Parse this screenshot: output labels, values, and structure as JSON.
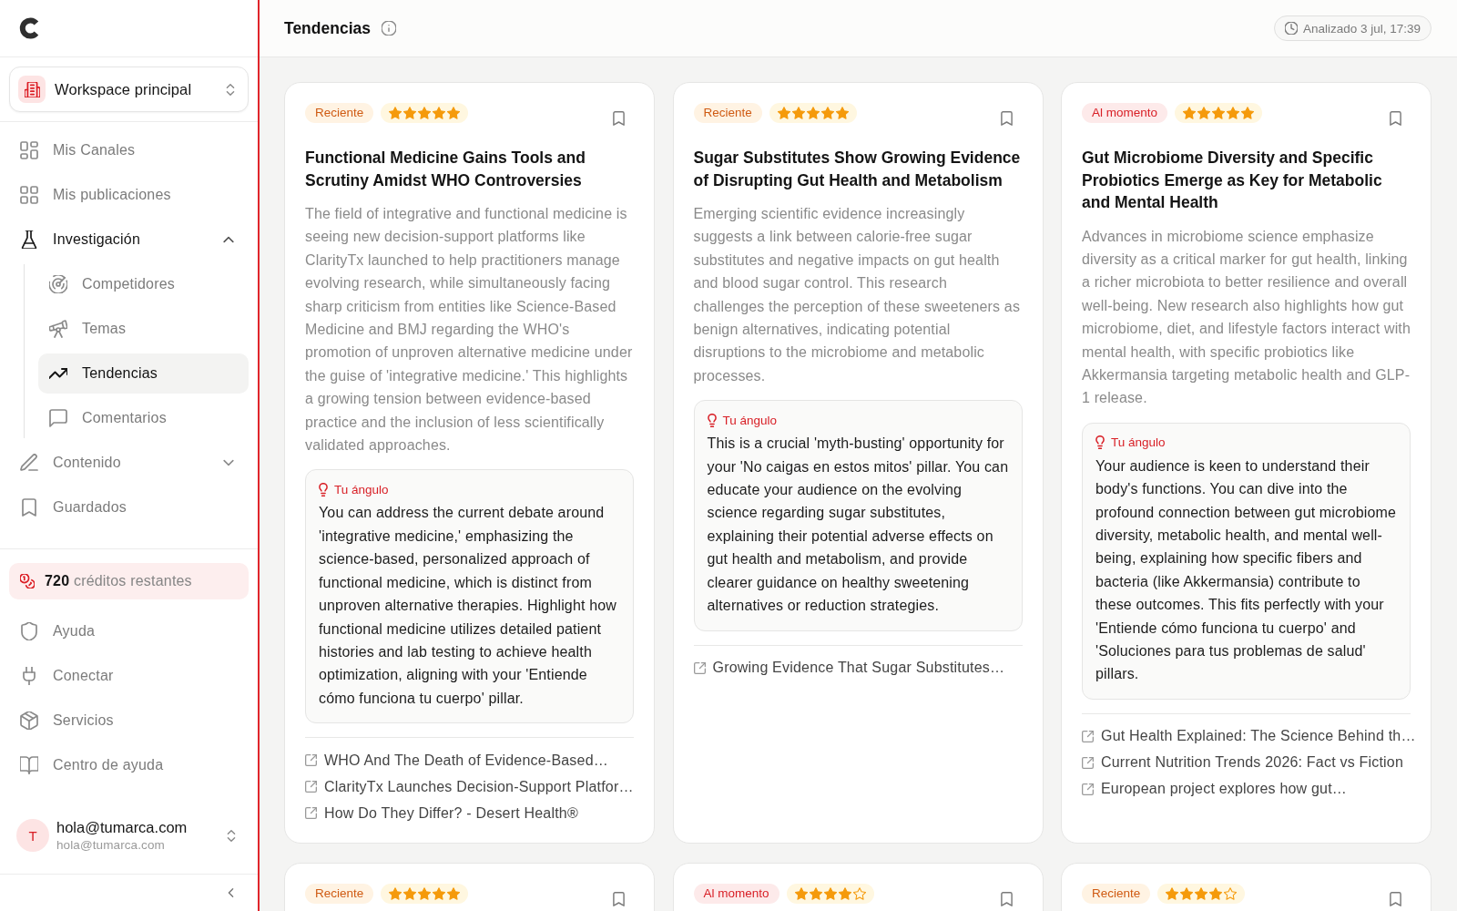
{
  "sidebar": {
    "workspace": {
      "name": "Workspace principal"
    },
    "nav": [
      {
        "label": "Mis Canales",
        "kind": "link",
        "selected": false
      },
      {
        "label": "Mis publicaciones",
        "kind": "link",
        "selected": false
      },
      {
        "label": "Investigación",
        "kind": "group",
        "selected": false,
        "expanded": true,
        "children": [
          {
            "label": "Competidores",
            "selected": false
          },
          {
            "label": "Temas",
            "selected": false
          },
          {
            "label": "Tendencias",
            "selected": true
          },
          {
            "label": "Comentarios",
            "selected": false
          }
        ]
      },
      {
        "label": "Contenido",
        "kind": "group",
        "selected": false,
        "expanded": false
      },
      {
        "label": "Guardados",
        "kind": "link",
        "selected": false
      }
    ],
    "credits": "**720** créditos restantes",
    "footer_nav": [
      {
        "label": "Ayuda",
        "selected": false
      },
      {
        "label": "Conectar",
        "selected": false
      },
      {
        "label": "Servicios",
        "selected": false
      },
      {
        "label": "Centro de ayuda",
        "selected": false
      }
    ],
    "user": {
      "initial": "T",
      "name": "hola@tumarca.com",
      "email": "hola@tumarca.com"
    }
  },
  "header": {
    "title": "Tendencias",
    "analyzed": "Analizado 3 jul, 17:39"
  },
  "cards": [
    {
      "badge": {
        "label": "Reciente",
        "kind": "recent"
      },
      "stars": 5,
      "title": "Functional Medicine Gains Tools and Scrutiny Amidst WHO Controversies",
      "summary": "The field of integrative and functional medicine is seeing new decision-support platforms like ClarityTx launched to help practitioners manage evolving research, while simultaneously facing sharp criticism from entities like Science-Based Medicine and BMJ regarding the WHO's promotion of unproven alternative medicine under the guise of 'integrative medicine.' This highlights a growing tension between evidence-based practice and the inclusion of less scientifically validated approaches.",
      "angle": {
        "label": "Tu ángulo",
        "text": "You can address the current debate around 'integrative medicine,' emphasizing the science-based, personalized approach of functional medicine, which is distinct from unproven alternative therapies. Highlight how functional medicine utilizes detailed patient histories and lab testing to achieve health optimization, aligning with your 'Entiende cómo funciona tu cuerpo' pillar."
      },
      "sources": [
        "WHO And The Death of Evidence-Based…",
        "ClarityTx Launches Decision-Support Platfor…",
        "How Do They Differ? - Desert Health®"
      ]
    },
    {
      "badge": {
        "label": "Reciente",
        "kind": "recent"
      },
      "stars": 5,
      "title": "Sugar Substitutes Show Growing Evidence of Disrupting Gut Health and Metabolism",
      "summary": "Emerging scientific evidence increasingly suggests a link between calorie-free sugar substitutes and negative impacts on gut health and blood sugar control. This research challenges the perception of these sweeteners as benign alternatives, indicating potential disruptions to the microbiome and metabolic processes.",
      "angle": {
        "label": "Tu ángulo",
        "text": "This is a crucial 'myth-busting' opportunity for your 'No caigas en estos mitos' pillar. You can educate your audience on the evolving science regarding sugar substitutes, explaining their potential adverse effects on gut health and metabolism, and provide clearer guidance on healthy sweetening alternatives or reduction strategies."
      },
      "sources": [
        "Growing Evidence That Sugar Substitutes…"
      ]
    },
    {
      "badge": {
        "label": "Al momento",
        "kind": "live"
      },
      "stars": 5,
      "title": "Gut Microbiome Diversity and Specific Probiotics Emerge as Key for Metabolic and Mental Health",
      "summary": "Advances in microbiome science emphasize diversity as a critical marker for gut health, linking a richer microbiota to better resilience and overall well-being. New research also highlights how gut microbiome, diet, and lifestyle factors interact with mental health, with specific probiotics like Akkermansia targeting metabolic health and GLP-1 release.",
      "angle": {
        "label": "Tu ángulo",
        "text": "Your audience is keen to understand their body's functions. You can dive into the profound connection between gut microbiome diversity, metabolic health, and mental well-being, explaining how specific fibers and bacteria (like Akkermansia) contribute to these outcomes. This fits perfectly with your 'Entiende cómo funciona tu cuerpo' and 'Soluciones para tus problemas de salud' pillars."
      },
      "sources": [
        "Gut Health Explained: The Science Behind th…",
        "Current Nutrition Trends 2026: Fact vs Fiction",
        "European project explores how gut…"
      ]
    },
    {
      "badge": {
        "label": "Reciente",
        "kind": "recent"
      },
      "stars": 5
    },
    {
      "badge": {
        "label": "Al momento",
        "kind": "live"
      },
      "stars": 4
    },
    {
      "badge": {
        "label": "Reciente",
        "kind": "recent"
      },
      "stars": 4
    }
  ]
}
